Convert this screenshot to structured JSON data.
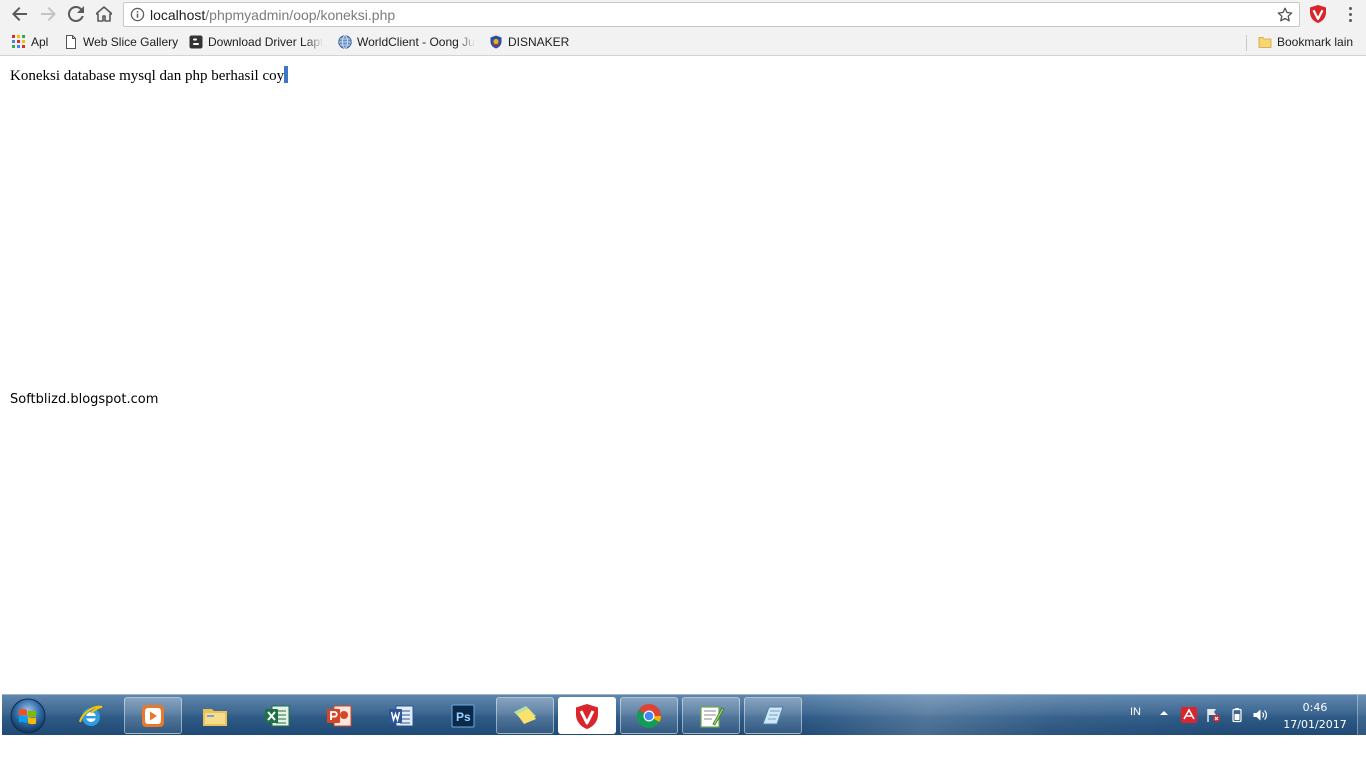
{
  "browser": {
    "nav": {
      "back_icon": "arrow-left-icon",
      "forward_icon": "arrow-right-icon",
      "reload_icon": "reload-icon",
      "home_icon": "home-icon"
    },
    "omnibox": {
      "url_host": "localhost",
      "url_path": "/phpmyadmin/oop/koneksi.php",
      "info_icon": "info-icon",
      "star_icon": "star-icon"
    },
    "extension_icon": "shield-icon",
    "menu_icon": "three-dots-icon"
  },
  "bookmarks": {
    "items": [
      {
        "label": "Apl",
        "icon": "apps-grid-icon"
      },
      {
        "label": "Web Slice Gallery",
        "icon": "page-icon"
      },
      {
        "label": "Download Driver Lapt",
        "icon": "blogger-icon"
      },
      {
        "label": "WorldClient - Oong Ju",
        "icon": "globe-icon"
      },
      {
        "label": "DISNAKER",
        "icon": "emblem-icon"
      }
    ],
    "other": {
      "label": "Bookmark lain",
      "icon": "folder-icon"
    }
  },
  "page": {
    "message": "Koneksi database mysql dan php berhasil coy",
    "watermark": "Softblizd.blogspot.com"
  },
  "taskbar": {
    "start_icon": "windows-start-icon",
    "apps": [
      {
        "name": "internet-explorer",
        "icon": "internet-explorer-icon"
      },
      {
        "name": "media-player",
        "icon": "media-player-icon"
      },
      {
        "name": "file-explorer",
        "icon": "folder-icon"
      },
      {
        "name": "excel",
        "icon": "excel-icon"
      },
      {
        "name": "powerpoint",
        "icon": "powerpoint-icon"
      },
      {
        "name": "word",
        "icon": "word-icon"
      },
      {
        "name": "photoshop",
        "icon": "photoshop-icon"
      },
      {
        "name": "sticky-notes",
        "icon": "sticky-notes-icon"
      },
      {
        "name": "antivirus",
        "icon": "shield-icon"
      },
      {
        "name": "chrome",
        "icon": "chrome-icon"
      },
      {
        "name": "notepad-plus",
        "icon": "notepad-plus-icon"
      },
      {
        "name": "notes-app",
        "icon": "notepad-icon"
      }
    ],
    "photoshop_label": "Ps",
    "tray": {
      "language": "IN",
      "time": "0:46",
      "date": "17/01/2017"
    }
  },
  "colors": {
    "accent_blue": "#3b79c4",
    "taskbar_base": "#2e5a86",
    "shield_red": "#d8262c"
  }
}
